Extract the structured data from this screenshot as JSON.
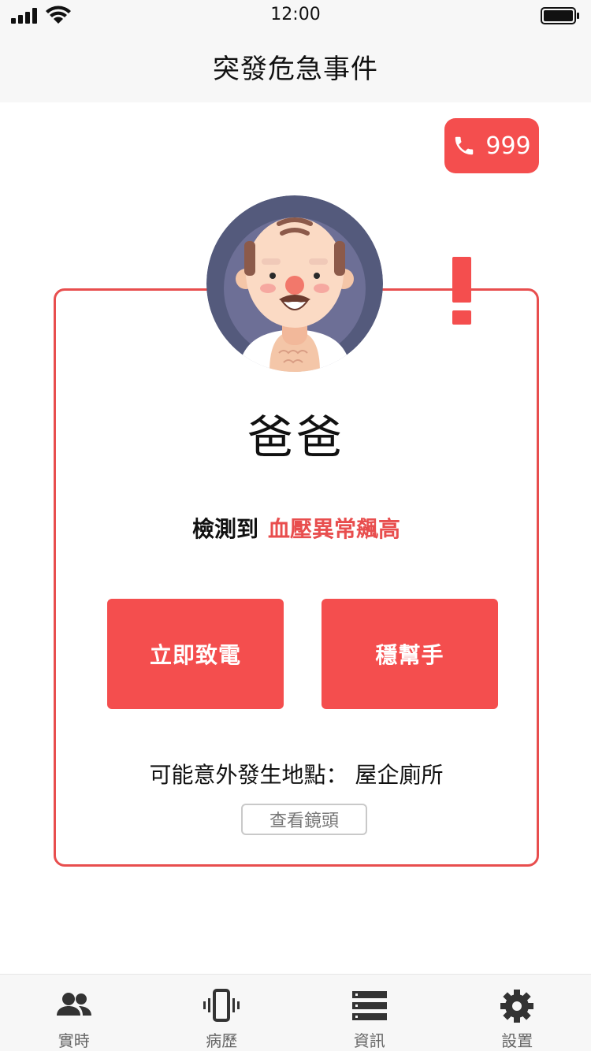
{
  "status_bar": {
    "time": "12:00"
  },
  "header": {
    "title": "突發危急事件"
  },
  "emergency_call": {
    "number": "999"
  },
  "card": {
    "name": "爸爸",
    "detected_label": "檢測到",
    "condition": "血壓異常飆高",
    "call_button": "立即致電",
    "help_button": "穩幫手",
    "location_label": "可能意外發生地點：",
    "location_value": "屋企廁所",
    "camera_button": "查看鏡頭"
  },
  "tabs": [
    {
      "label": "實時",
      "icon": "people-icon"
    },
    {
      "label": "病歷",
      "icon": "vibrate-icon"
    },
    {
      "label": "資訊",
      "icon": "list-icon"
    },
    {
      "label": "設置",
      "icon": "gear-icon"
    }
  ],
  "colors": {
    "accent": "#f44e4e",
    "text": "#111111",
    "bar_bg": "#f7f7f7"
  }
}
